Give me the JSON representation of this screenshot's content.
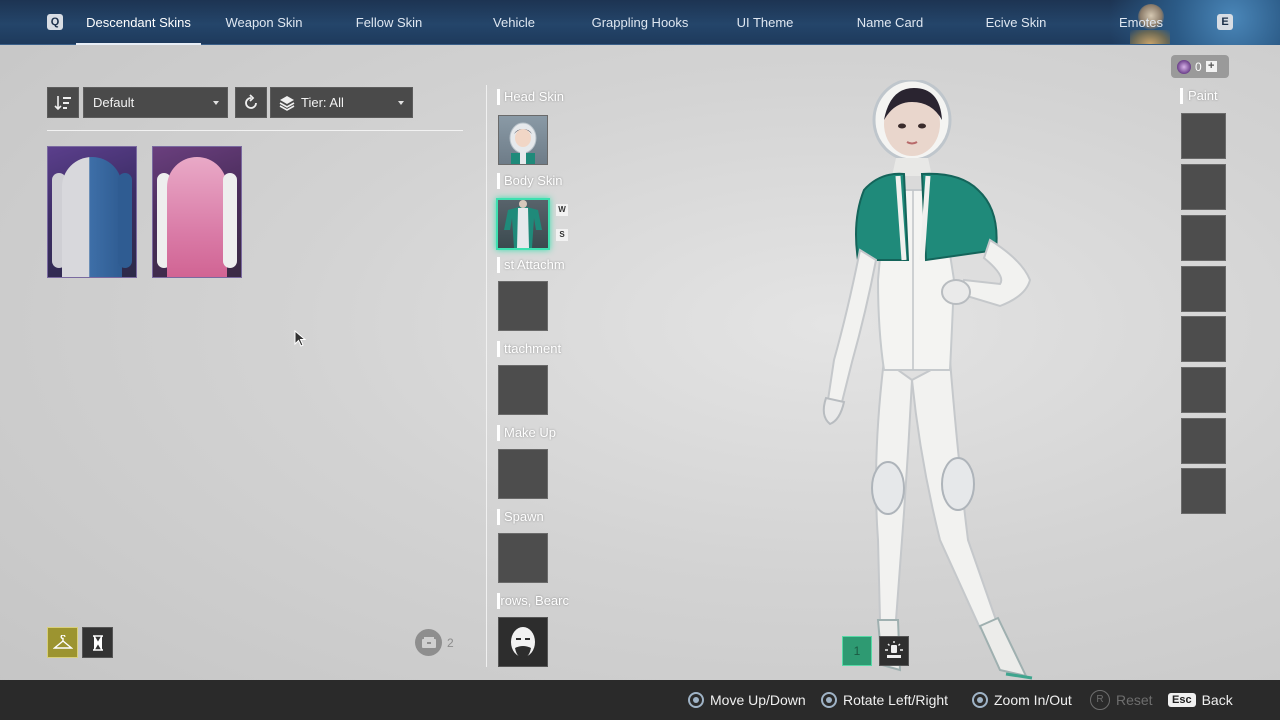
{
  "nav": {
    "prev_key": "Q",
    "next_key": "E",
    "tabs": [
      {
        "label": "Descendant Skins",
        "active": true
      },
      {
        "label": "Weapon Skin"
      },
      {
        "label": "Fellow Skin"
      },
      {
        "label": "Vehicle"
      },
      {
        "label": "Grappling Hooks"
      },
      {
        "label": "UI Theme"
      },
      {
        "label": "Name Card"
      },
      {
        "label": "Ecive Skin"
      },
      {
        "label": "Emotes"
      }
    ]
  },
  "filters": {
    "sort_value": "Default",
    "tier_value": "Tier: All"
  },
  "inventory": {
    "skins": [
      {
        "icon": "blue-white-jacket-skin"
      },
      {
        "icon": "pink-nurse-outfit-skin"
      }
    ],
    "count": "2"
  },
  "slots": {
    "head": "Head Skin",
    "body": "Body Skin",
    "body_tag_w": "W",
    "body_tag_s": "S",
    "attach1": "st Attachm",
    "attach2": "ttachment",
    "makeup": "Make Up",
    "spawn": "Spawn",
    "brows": "rows, Bearc"
  },
  "currency": {
    "amount": "0",
    "plus": "+"
  },
  "paint": {
    "label": "Paint",
    "slot_count": 8
  },
  "preset": {
    "number": "1"
  },
  "footer": {
    "move": "Move Up/Down",
    "rotate": "Rotate Left/Right",
    "zoom": "Zoom In/Out",
    "reset_key": "R",
    "reset": "Reset",
    "back_key": "Esc",
    "back": "Back"
  },
  "colors": {
    "nav_bg": "#24456a",
    "selected_glow": "#3ee0b0",
    "wardrobe_active": "#9c9430",
    "suit_teal": "#1f8a7a"
  }
}
